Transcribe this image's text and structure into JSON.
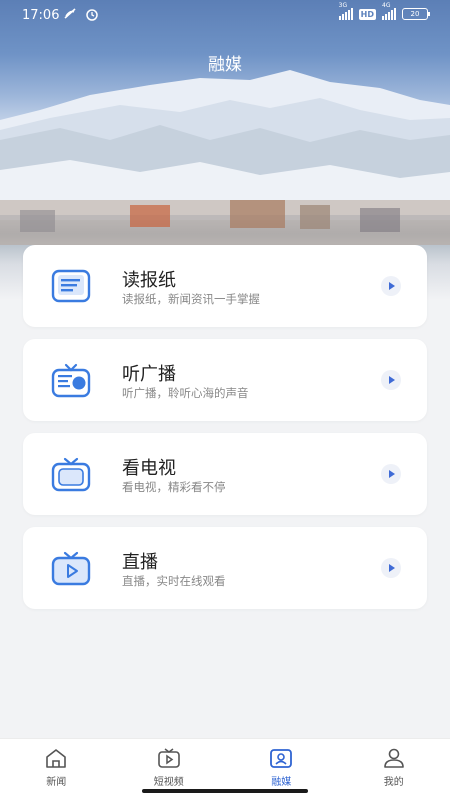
{
  "status_bar": {
    "time": "17:06",
    "net1": "3G",
    "net2": "4G",
    "hd": "HD",
    "battery": "20"
  },
  "header": {
    "title": "融媒"
  },
  "cards": [
    {
      "title": "读报纸",
      "subtitle": "读报纸，新闻资讯一手掌握",
      "icon": "newspaper-icon"
    },
    {
      "title": "听广播",
      "subtitle": "听广播，聆听心海的声音",
      "icon": "radio-icon"
    },
    {
      "title": "看电视",
      "subtitle": "看电视，精彩看不停",
      "icon": "tv-icon"
    },
    {
      "title": "直播",
      "subtitle": "直播，实时在线观看",
      "icon": "live-tv-icon"
    }
  ],
  "tabbar": {
    "items": [
      {
        "label": "新闻",
        "icon": "home-icon"
      },
      {
        "label": "短视频",
        "icon": "video-icon"
      },
      {
        "label": "融媒",
        "icon": "media-icon",
        "active": true
      },
      {
        "label": "我的",
        "icon": "user-icon"
      }
    ]
  },
  "colors": {
    "accent": "#2f64d2",
    "icon_blue": "#3a7be0"
  }
}
